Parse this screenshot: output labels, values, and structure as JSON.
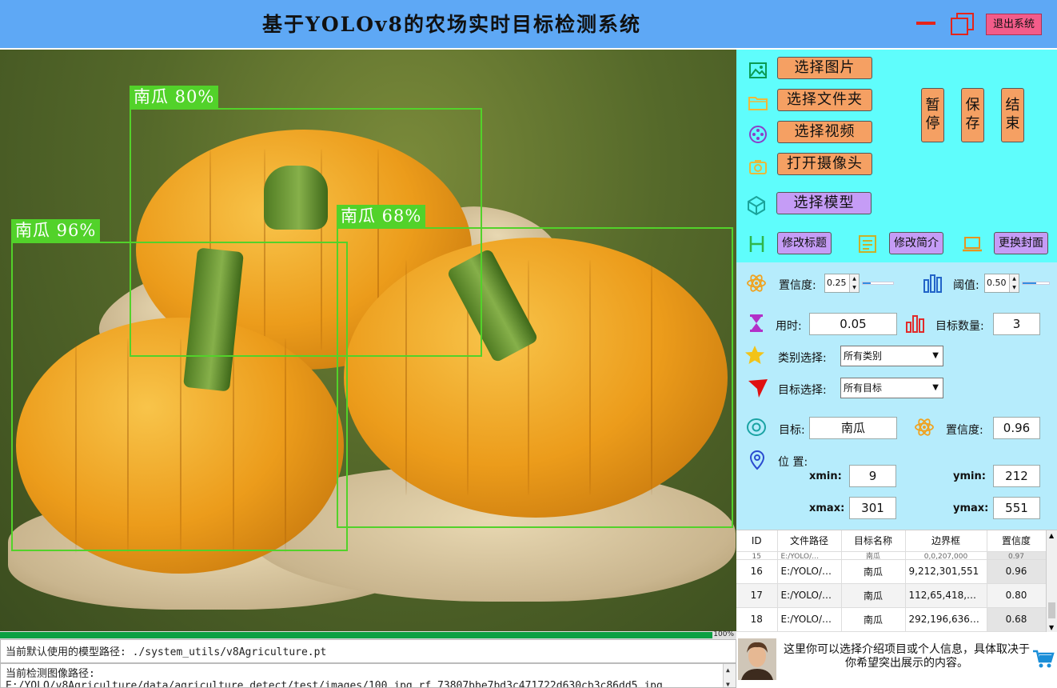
{
  "window": {
    "title": "基于YOLOv8的农场实时目标检测系统",
    "exit_label": "退出系统"
  },
  "detections": [
    {
      "label": "南瓜 80%"
    },
    {
      "label": "南瓜 96%"
    },
    {
      "label": "南瓜 68%"
    }
  ],
  "progress": {
    "value": 100,
    "label": "100%"
  },
  "status": {
    "model_path": "当前默认使用的模型路径: ./system_utils/v8Agriculture.pt",
    "image_path": "当前检测图像路径: E:/YOLO/v8Agriculture/data/agriculture_detect/test/images/100_jpg.rf.73807bbe7bd3c471722d630cb3c86dd5.jpg"
  },
  "buttons": {
    "select_image": "选择图片",
    "select_folder": "选择文件夹",
    "select_video": "选择视频",
    "open_camera": "打开摄像头",
    "select_model": "选择模型",
    "pause": "暂停",
    "save": "保存",
    "stop": "结束",
    "edit_title": "修改标题",
    "edit_intro": "修改简介",
    "change_cover": "更换封面"
  },
  "params": {
    "confidence_label": "置信度:",
    "confidence_value": "0.25",
    "confidence_fraction": 0.25,
    "iou_label": "阈值:",
    "iou_value": "0.50",
    "iou_fraction": 0.5,
    "time_label": "用时:",
    "time_value": "0.05",
    "count_label": "目标数量:",
    "count_value": "3",
    "class_label": "类别选择:",
    "class_value": "所有类别",
    "target_label": "目标选择:",
    "target_value": "所有目标",
    "object_label": "目标:",
    "object_value": "南瓜",
    "obj_conf_label": "置信度:",
    "obj_conf_value": "0.96",
    "position_label": "位 置:",
    "xmin_label": "xmin:",
    "xmin_value": "9",
    "ymin_label": "ymin:",
    "ymin_value": "212",
    "xmax_label": "xmax:",
    "xmax_value": "301",
    "ymax_label": "ymax:",
    "ymax_value": "551"
  },
  "table": {
    "headers": [
      "ID",
      "文件路径",
      "目标名称",
      "边界框",
      "置信度"
    ],
    "partial_row": [
      "15",
      "E:/YOLO/…",
      "南瓜",
      "0,0,207,000",
      "0.97"
    ],
    "rows": [
      [
        "16",
        "E:/YOLO/…",
        "南瓜",
        "9,212,301,551",
        "0.96"
      ],
      [
        "17",
        "E:/YOLO/…",
        "南瓜",
        "112,65,418,…",
        "0.80"
      ],
      [
        "18",
        "E:/YOLO/…",
        "南瓜",
        "292,196,636…",
        "0.68"
      ]
    ]
  },
  "footer": {
    "intro": "这里你可以选择介绍项目或个人信息，具体取决于你希望突出展示的内容。"
  },
  "colors": {
    "title_bar": "#5ea8f5",
    "panel_top": "#5ffdfc",
    "panel_mid": "#b6ecfc",
    "button_orange": "#f5a063",
    "button_purple": "#c59cf6",
    "bbox_green": "#52d22a",
    "progress_green": "#0ca043",
    "exit_pink": "#f35c8a"
  },
  "icons": {
    "select_image": "image-icon",
    "select_folder": "folder-icon",
    "select_video": "film-reel-icon",
    "open_camera": "camera-icon",
    "select_model": "model-cube-icon",
    "edit_title": "heading-icon",
    "edit_intro": "document-icon",
    "change_cover": "laptop-icon",
    "confidence": "atom-icon",
    "iou": "bar-slider-icon",
    "time": "hourglass-icon",
    "count": "bar-chart-icon",
    "class": "star-icon",
    "target": "cursor-arrow-icon",
    "object": "eye-icon",
    "obj_conf": "atom-icon",
    "position": "location-pin-icon",
    "cart": "shopping-cart-icon"
  }
}
